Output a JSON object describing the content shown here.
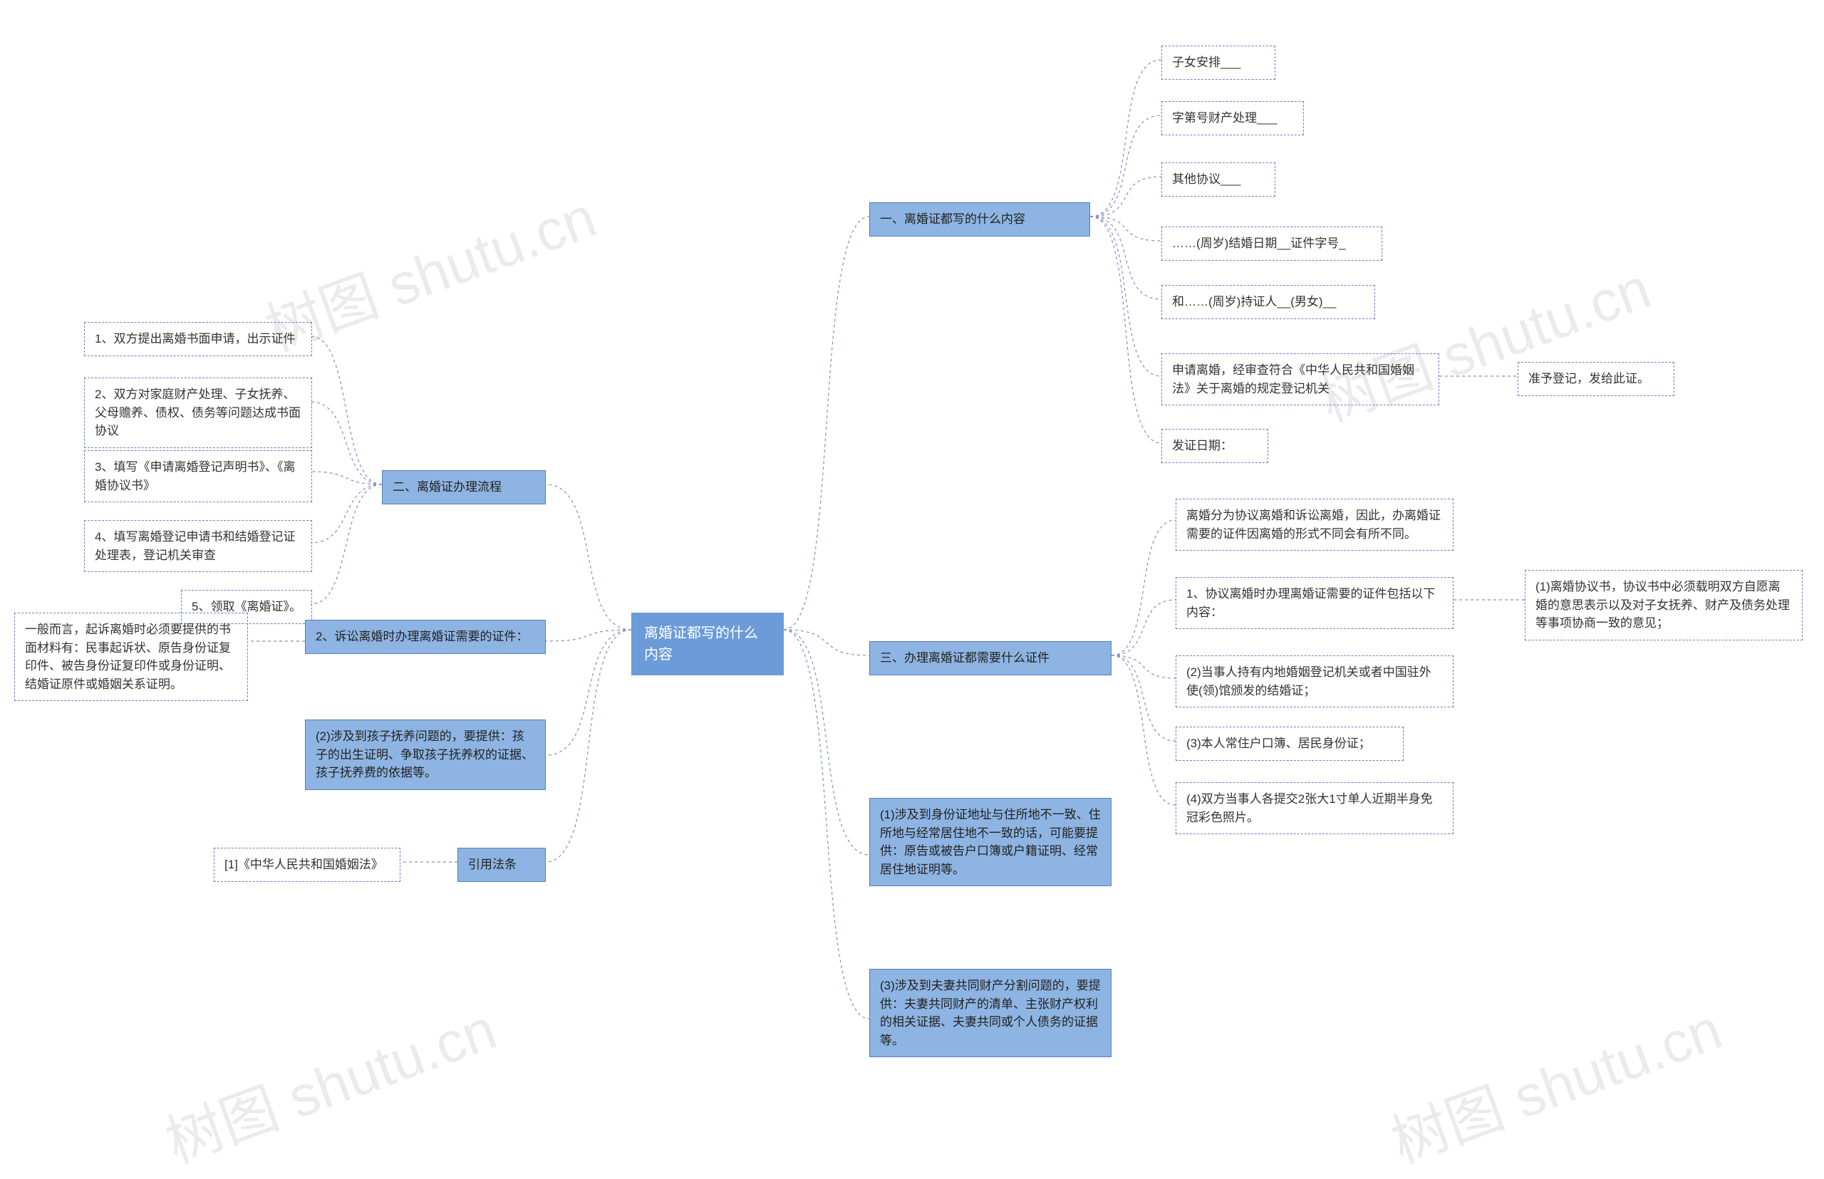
{
  "watermark": "树图 shutu.cn",
  "root": "离婚证都写的什么内容",
  "branches": {
    "b1": {
      "title": "一、离婚证都写的什么内容",
      "items": [
        "子女安排___",
        "字第号财产处理___",
        "其他协议___",
        "……(周岁)结婚日期__证件字号_",
        "和……(周岁)持证人__(男女)__",
        "申请离婚，经审查符合《中华人民共和国婚姻法》关于离婚的规定登记机关",
        "发证日期："
      ],
      "sub6": "准予登记，发给此证。"
    },
    "b2": {
      "title": "二、离婚证办理流程",
      "items": [
        "1、双方提出离婚书面申请，出示证件",
        "2、双方对家庭财产处理、子女抚养、父母赡养、债权、债务等问题达成书面协议",
        "3、填写《申请离婚登记声明书》、《离婚协议书》",
        "4、填写离婚登记申请书和结婚登记证处理表，登记机关审查",
        "5、领取《离婚证》。"
      ]
    },
    "b3": {
      "title": "三、办理离婚证都需要什么证件",
      "intro": "离婚分为协议离婚和诉讼离婚，因此，办离婚证需要的证件因离婚的形式不同会有所不同。",
      "item1": "1、协议离婚时办理离婚证需要的证件包括以下内容：",
      "item1sub": "(1)离婚协议书，协议书中必须载明双方自愿离婚的意思表示以及对子女抚养、财产及债务处理等事项协商一致的意见；",
      "item2": "(2)当事人持有内地婚姻登记机关或者中国驻外使(领)馆颁发的结婚证；",
      "item3": "(3)本人常住户口簿、居民身份证；",
      "item4": "(4)双方当事人各提交2张大1寸单人近期半身免冠彩色照片。"
    },
    "b4": {
      "title": "2、诉讼离婚时办理离婚证需要的证件：",
      "sub": "一般而言，起诉离婚时必须要提供的书面材料有：民事起诉状、原告身份证复印件、被告身份证复印件或身份证明、结婚证原件或婚姻关系证明。"
    },
    "b5": {
      "title": "(2)涉及到孩子抚养问题的，要提供：孩子的出生证明、争取孩子抚养权的证据、孩子抚养费的依据等。"
    },
    "b6": {
      "title": "引用法条",
      "sub": "[1]《中华人民共和国婚姻法》"
    },
    "rchild1": "(1)涉及到身份证地址与住所地不一致、住所地与经常居住地不一致的话，可能要提供：原告或被告户口簿或户籍证明、经常居住地证明等。",
    "rchild2": "(3)涉及到夫妻共同财产分割问题的，要提供：夫妻共同财产的清单、主张财产权利的相关证据、夫妻共同或个人债务的证据等。"
  }
}
